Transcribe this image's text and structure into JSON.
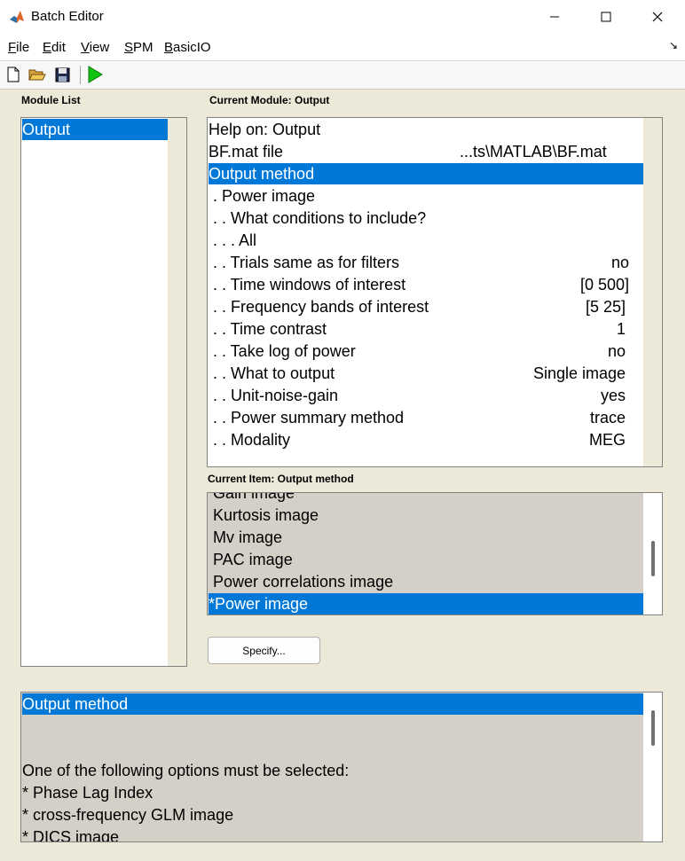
{
  "window": {
    "title": "Batch Editor"
  },
  "menu": {
    "file": "File",
    "edit": "Edit",
    "view": "View",
    "spm": "SPM",
    "basicio": "BasicIO"
  },
  "module_list": {
    "label": "Module List",
    "items": [
      "Output"
    ]
  },
  "current_module": {
    "label": "Current Module: Output",
    "rows": [
      {
        "text": "Help on: Output",
        "value": ""
      },
      {
        "text": "BF.mat file",
        "value": "...ts\\MATLAB\\BF.mat"
      },
      {
        "text": "Output method",
        "value": ""
      },
      {
        "text": " . Power image",
        "value": ""
      },
      {
        "text": " . . What conditions to include?",
        "value": ""
      },
      {
        "text": " . . . All",
        "value": ""
      },
      {
        "text": " . . Trials same as for filters",
        "value": "no"
      },
      {
        "text": " . . Time windows of interest",
        "value": "[0 500]"
      },
      {
        "text": " . . Frequency bands of interest",
        "value": "[5 25]"
      },
      {
        "text": " . . Time contrast",
        "value": "1"
      },
      {
        "text": " . . Take log of power",
        "value": "no"
      },
      {
        "text": " . . What to output",
        "value": "Single image"
      },
      {
        "text": " . . Unit-noise-gain",
        "value": "yes"
      },
      {
        "text": " . . Power summary method",
        "value": "trace"
      },
      {
        "text": " . . Modality",
        "value": "MEG"
      }
    ]
  },
  "current_item": {
    "label": "Current Item: Output method",
    "items": [
      " Gain image",
      " Kurtosis image",
      " Mv image",
      " PAC image",
      " Power correlations image",
      "*Power image"
    ]
  },
  "specify_label": "Specify...",
  "help": {
    "lines": [
      "Output method",
      "",
      "",
      "One of the following options must be selected:",
      "* Phase Lag Index",
      "* cross-frequency GLM image",
      "* DICS image"
    ]
  }
}
